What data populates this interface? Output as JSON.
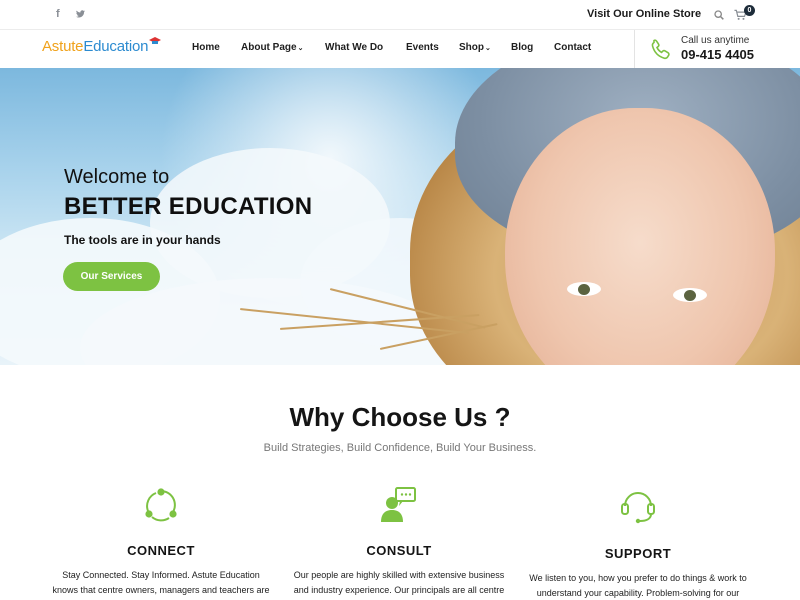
{
  "topbar": {
    "social": {
      "facebook": "f",
      "twitter": "t"
    },
    "store_link": "Visit Our Online Store",
    "cart_count": "0",
    "icons": [
      "facebook-icon",
      "twitter-icon",
      "search-icon",
      "cart-icon"
    ]
  },
  "brand": {
    "part1": "Astute",
    "part2": "Education",
    "accent": "#f0a21c",
    "brand_blue": "#2c8bd0"
  },
  "nav": {
    "items": [
      {
        "label": "Home",
        "dropdown": false
      },
      {
        "label": "About Page",
        "dropdown": true
      },
      {
        "label": "What We Do",
        "dropdown": false
      },
      {
        "label": "Events",
        "dropdown": false
      },
      {
        "label": "Shop",
        "dropdown": true
      },
      {
        "label": "Blog",
        "dropdown": false
      },
      {
        "label": "Contact",
        "dropdown": false
      }
    ],
    "dropdown_glyph": "⌄"
  },
  "call": {
    "label": "Call us anytime",
    "number": "09-415 4405",
    "icon": "phone-icon",
    "icon_color": "#7dc242"
  },
  "hero": {
    "line1": "Welcome to",
    "line2": "BETTER EDUCATION",
    "line3": "The tools are in your hands",
    "button": "Our Services",
    "button_color": "#7dc242"
  },
  "why": {
    "title": "Why Choose Us ?",
    "subtitle": "Build Strategies, Build Confidence, Build Your Business."
  },
  "features": [
    {
      "icon": "connect-network-icon",
      "title": "CONNECT",
      "line1": "Stay Connected. Stay Informed. Astute Education",
      "line2": "knows that centre owners, managers and teachers are"
    },
    {
      "icon": "consult-person-chat-icon",
      "title": "CONSULT",
      "line1": "Our people are highly skilled with extensive business",
      "line2": "and industry experience. Our principals are all centre"
    },
    {
      "icon": "support-headset-icon",
      "title": "SUPPORT",
      "line1": "We listen to you, how you prefer to do things & work to",
      "line2": "understand your capability. Problem-solving for our"
    }
  ],
  "colors": {
    "green": "#7dc242",
    "dark": "#151515"
  }
}
